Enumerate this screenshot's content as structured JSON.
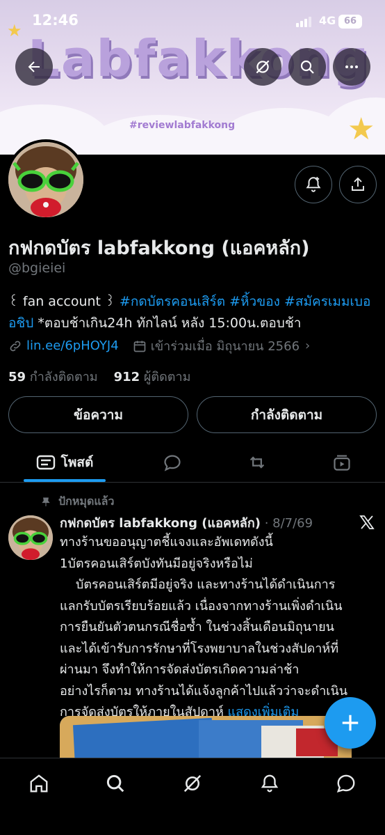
{
  "status_bar": {
    "time": "12:46",
    "network": "4G",
    "battery": "66"
  },
  "banner": {
    "title": "Labfakkong",
    "hashtag": "#reviewlabfakkong"
  },
  "profile": {
    "name": "กฟกดบัตร labfakkong (แอคหลัก)",
    "handle": "@bgieiei",
    "bio_prefix": "꒰ fan account ꒱ ",
    "bio_tags": [
      "#กดบัตรคอนเสิร์ต",
      "#หิ้วของ",
      "#สมัครเมมเบอ"
    ],
    "bio_tag_wrap": "อชิป",
    "bio_suffix": " *ตอบช้าเกิน24h ทักไลน์ หลัง 15:00น.ตอบช้า",
    "link": "lin.ee/6pHOYJ4",
    "joined": "เข้าร่วมเมื่อ มิถุนายน 2566",
    "following_count": "59",
    "following_label": "กำลังติดตาม",
    "followers_count": "912",
    "followers_label": "ผู้ติดตาม"
  },
  "buttons": {
    "message": "ข้อความ",
    "following": "กำลังติดตาม"
  },
  "tabs": {
    "posts": "โพสต์"
  },
  "post": {
    "pinned_label": "ปักหมุดแล้ว",
    "author": "กฟกดบัตร labfakkong (แอคหลัก)",
    "date": "· 8/7/69",
    "lines": [
      "ทางร้านขออนุญาตชี้แจงและอัพเดทดังนี้",
      "1บัตรคอนเสิร์ตบังทันมีอยู่จริงหรือไม่",
      "    บัตรคอนเสิร์ตมีอยู่จริง และทางร้านได้ดำเนินการ",
      "แลกรับบัตรเรียบร้อยแล้ว เนื่องจากทางร้านเพิ่งดำเนิน",
      "การยืนยันตัวตนกรณีชื่อซ้ำ ในช่วงสิ้นเดือนมิถุนายน",
      "และได้เข้ารับการรักษาที่โรงพยาบาลในช่วงสัปดาห์ที่",
      "ผ่านมา จึงทำให้การจัดส่งบัตรเกิดความล่าช้า",
      "อย่างไรก็ตาม ทางร้านได้แจ้งลูกค้าไปแล้วว่าจะดำเนิน"
    ],
    "last_line": "การจัดส่งบัตรให้ภายในสัปดาห์ ",
    "show_more": "แสดงเพิ่มเติม"
  },
  "colors": {
    "accent": "#1d9bf0",
    "secondary_text": "#71767b",
    "border": "#536471"
  }
}
